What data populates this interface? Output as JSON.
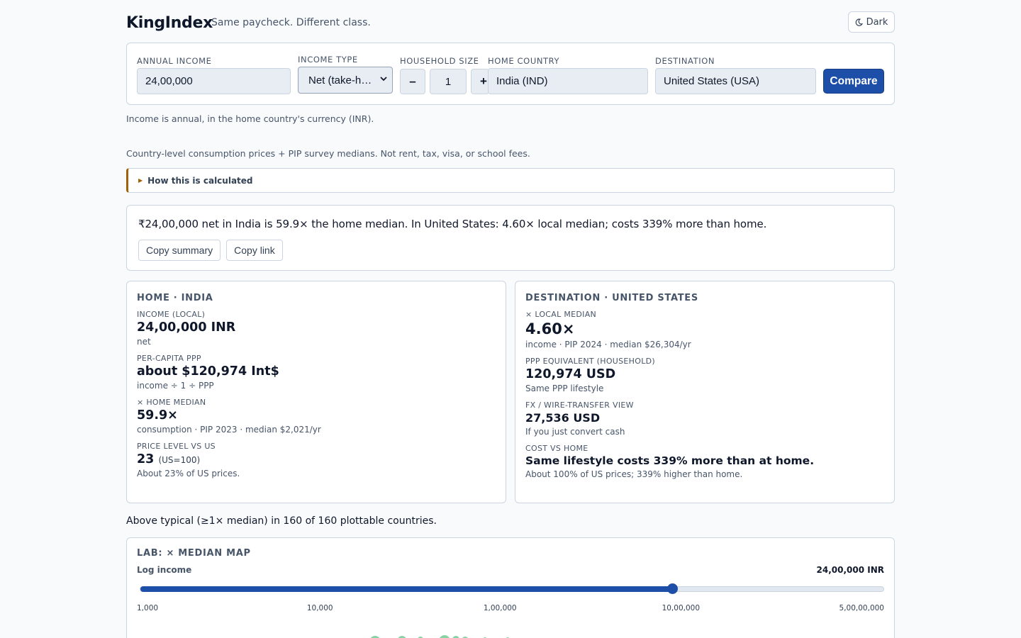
{
  "header": {
    "brand": "KingIndex",
    "tagline": "Same paycheck. Different class.",
    "theme_toggle_label": "Dark"
  },
  "form": {
    "annual_income_label": "ANNUAL INCOME",
    "annual_income_value": "24,00,000",
    "income_type_label": "INCOME TYPE",
    "income_type_value": "Net (take-h…",
    "household_size_label": "HOUSEHOLD SIZE",
    "household_minus": "–",
    "household_value": "1",
    "household_plus": "+",
    "home_country_label": "HOME COUNTRY",
    "home_country_value": "India (IND)",
    "destination_label": "DESTINATION",
    "destination_value": "United States (USA)",
    "compare_label": "Compare"
  },
  "notes": {
    "currency_note": "Income is annual, in the home country's currency (INR).",
    "scope_note": "Country-level consumption prices + PIP survey medians. Not rent, tax, visa, or school fees."
  },
  "details": {
    "label": "How this is calculated"
  },
  "summary": {
    "text": "₹24,00,000 net in India is 59.9× the home median. In United States: 4.60× local median; costs 339% more than home.",
    "copy_summary_label": "Copy summary",
    "copy_link_label": "Copy link"
  },
  "home": {
    "title": "HOME · INDIA",
    "income_label": "INCOME (LOCAL)",
    "income_value": "24,00,000 INR",
    "income_sub": "net",
    "ppp_label": "PER-CAPITA PPP",
    "ppp_value": "about $120,974 Int$",
    "ppp_sub": "income ÷ 1 ÷ PPP",
    "median_label": "× HOME MEDIAN",
    "median_value": "59.9×",
    "median_sub": "consumption · PIP 2023 · median $2,021/yr",
    "price_label": "PRICE LEVEL VS US",
    "price_value": "23",
    "price_unit": "(US=100)",
    "price_sub": "About 23% of US prices."
  },
  "destination": {
    "title": "DESTINATION · UNITED STATES",
    "median_label": "× LOCAL MEDIAN",
    "median_value": "4.60×",
    "median_sub": "income · PIP 2024 · median $26,304/yr",
    "ppp_label": "PPP EQUIVALENT (HOUSEHOLD)",
    "ppp_value": "120,974 USD",
    "ppp_sub": "Same PPP lifestyle",
    "fx_label": "FX / WIRE-TRANSFER VIEW",
    "fx_value": "27,536 USD",
    "fx_sub": "If you just convert cash",
    "cost_label": "COST VS HOME",
    "cost_value": "Same lifestyle costs 339% more than at home.",
    "cost_sub": "About 100% of US prices; 339% higher than home."
  },
  "above_typical": "Above typical (≥1× median) in 160 of 160 plottable countries.",
  "lab": {
    "title": "LAB: × MEDIAN MAP",
    "slider_label": "Log income",
    "slider_value_label": "24,00,000 INR",
    "slider_fraction": 0.716,
    "ticks": [
      "1,000",
      "10,000",
      "1,00,000",
      "10,00,000",
      "5,00,00,000"
    ]
  },
  "colors": {
    "accent": "#1e4fa8",
    "details_accent": "#a16207",
    "map_dot": "#86d4a3"
  }
}
